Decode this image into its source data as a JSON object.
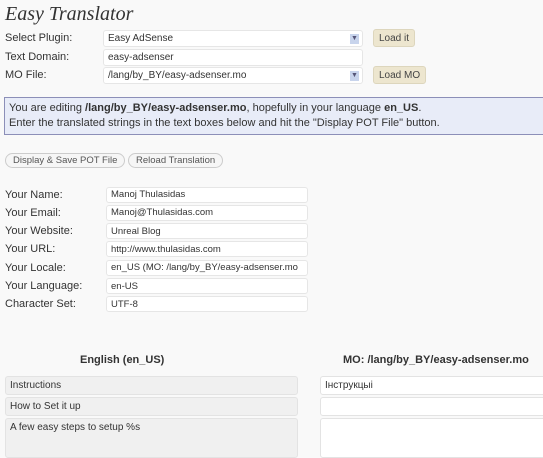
{
  "title": "Easy Translator",
  "form": {
    "plugin_label": "Select Plugin:",
    "plugin_value": "Easy AdSense",
    "load_it": "Load it",
    "domain_label": "Text Domain:",
    "domain_value": "easy-adsenser",
    "mo_label": "MO File:",
    "mo_value": "/lang/by_BY/easy-adsenser.mo",
    "load_mo": "Load MO"
  },
  "info": {
    "p1": "You are editing ",
    "file": "/lang/by_BY/easy-adsenser.mo",
    "p2": ", hopefully in your language ",
    "lang": "en_US",
    "p3": ".",
    "line2": "Enter the translated strings in the text boxes below and hit the \"Display POT File\" button."
  },
  "buttons": {
    "display": "Display & Save POT File",
    "reload": "Reload Translation"
  },
  "profile": [
    {
      "label": "Your Name:",
      "value": "Manoj Thulasidas"
    },
    {
      "label": "Your Email:",
      "value": "Manoj@Thulasidas.com"
    },
    {
      "label": "Your Website:",
      "value": "Unreal Blog"
    },
    {
      "label": "Your URL:",
      "value": "http://www.thulasidas.com"
    },
    {
      "label": "Your Locale:",
      "value": "en_US (MO: /lang/by_BY/easy-adsenser.mo"
    },
    {
      "label": "Your Language:",
      "value": "en-US"
    },
    {
      "label": "Character Set:",
      "value": "UTF-8"
    }
  ],
  "table": {
    "head_en": "English (en_US)",
    "head_mo": "MO: /lang/by_BY/easy-adsenser.mo",
    "rows": [
      {
        "en": "Instructions",
        "tr": "Інструкцыі"
      },
      {
        "en": "How to Set it up",
        "tr": ""
      },
      {
        "en": "A few easy steps to setup %s",
        "tr": ""
      }
    ]
  }
}
